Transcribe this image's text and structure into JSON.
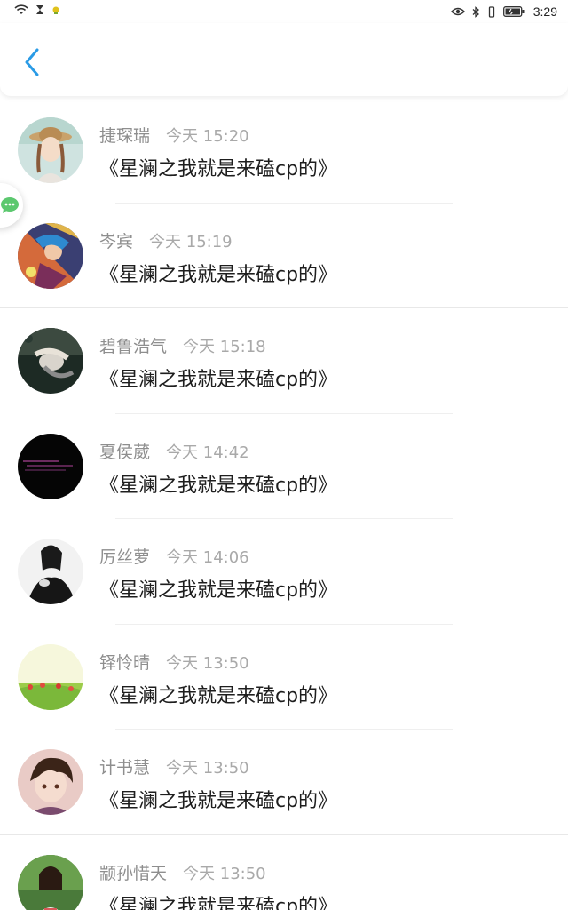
{
  "status_bar": {
    "time": "3:29",
    "icons": [
      "wifi-icon",
      "hourglass-icon",
      "notification-icon",
      "eye-icon",
      "bluetooth-icon",
      "vibrate-icon",
      "battery-icon"
    ]
  },
  "header": {
    "back_icon": "chevron-left-icon",
    "accent": "#2a9be6"
  },
  "floating_button": {
    "icon": "chat-bubble-icon",
    "color": "#5cc86f"
  },
  "comments": [
    {
      "name": "捷琛瑞",
      "time": "今天 15:20",
      "content": "《星澜之我就是来磕cp的》",
      "avatar": "girl-straw-hat"
    },
    {
      "name": "岑宾",
      "time": "今天 15:19",
      "content": "《星澜之我就是来磕cp的》",
      "avatar": "game-character"
    },
    {
      "name": "碧鲁浩气",
      "time": "今天 15:18",
      "content": "《星澜之我就是来磕cp的》",
      "avatar": "lying-figure"
    },
    {
      "name": "夏侯葳",
      "time": "今天 14:42",
      "content": "《星澜之我就是来磕cp的》",
      "avatar": "dark-text"
    },
    {
      "name": "厉丝萝",
      "time": "今天 14:06",
      "content": "《星澜之我就是来磕cp的》",
      "avatar": "woman-black-white"
    },
    {
      "name": "铎怜晴",
      "time": "今天 13:50",
      "content": "《星澜之我就是来磕cp的》",
      "avatar": "tulip-field"
    },
    {
      "name": "计书慧",
      "time": "今天 13:50",
      "content": "《星澜之我就是来磕cp的》",
      "avatar": "anime-boy"
    },
    {
      "name": "颛孙惜天",
      "time": "今天 13:50",
      "content": "《星澜之我就是来磕cp的》",
      "avatar": "girl-green"
    }
  ]
}
